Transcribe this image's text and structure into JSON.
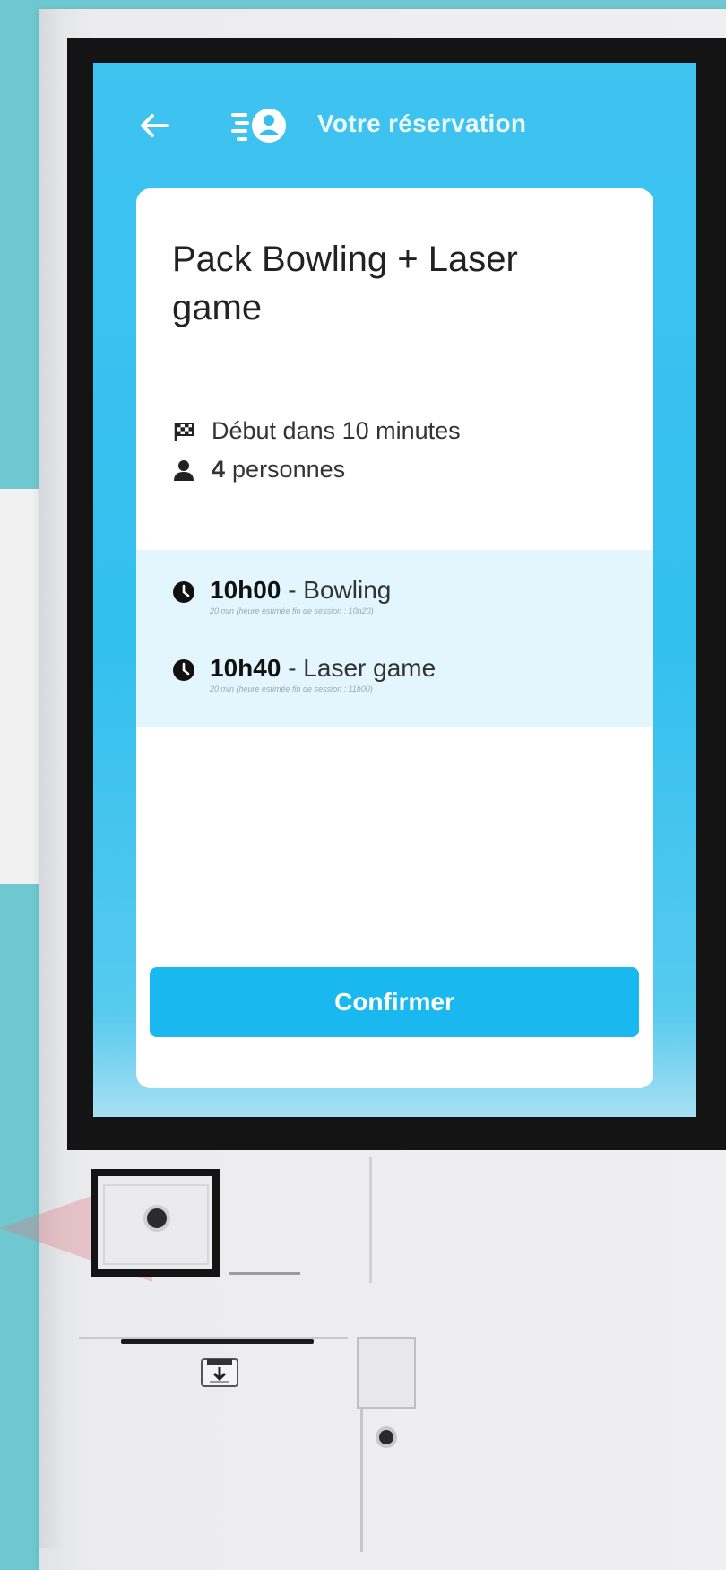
{
  "header": {
    "title": "Votre réservation",
    "back_icon": "arrow-left-icon",
    "logo_icon": "speedy-user-icon"
  },
  "booking": {
    "title": "Pack Bowling + Laser game",
    "start": "Début dans 10 minutes",
    "people_count": "4",
    "people_label": "personnes",
    "sessions": [
      {
        "time": "10h00",
        "activity": "Bowling",
        "note": "20 min (heure estimée fin de session : 10h20)"
      },
      {
        "time": "10h40",
        "activity": "Laser game",
        "note": "20 min (heure estimée fin de session : 11h00)"
      }
    ]
  },
  "actions": {
    "confirm_label": "Confirmer"
  },
  "colors": {
    "accent": "#19b8ee",
    "screen": "#3fc3f0",
    "sessions_bg": "#e4f6fd",
    "backdrop": "#6fc8cf"
  }
}
